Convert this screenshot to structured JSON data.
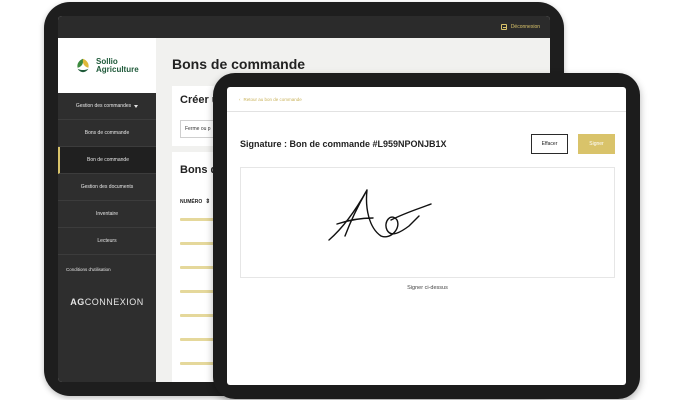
{
  "back_app": {
    "logout_label": "Déconnexion",
    "logo_line1": "Sollio",
    "logo_line2": "Agriculture",
    "sidebar": {
      "group_label": "Gestion des commandes",
      "items": [
        {
          "label": "Bons de commande"
        },
        {
          "label": "Bon de commande"
        },
        {
          "label": "Gestion des documents"
        },
        {
          "label": "Inventaire"
        },
        {
          "label": "Lecteurs"
        }
      ],
      "terms_label": "Conditions d'utilisation",
      "brand_bold": "AG",
      "brand_rest": "CONNEXION"
    },
    "page_title": "Bons de commande",
    "create_card_title": "Créer u",
    "farm_field_value": "Ferme ou p",
    "list_card_title": "Bons d",
    "number_col_label": "NUMÉRO"
  },
  "front_app": {
    "back_link": "Retour au bon de commande",
    "signature_title": "Signature : Bon de commande #L959NPONJB1X",
    "clear_button": "Effacer",
    "sign_button": "Signer",
    "signature_caption": "Signer ci-dessus"
  },
  "colors": {
    "accent_gold": "#d9c36a",
    "sidebar_dark": "#2e2e2e",
    "brand_green": "#1f5a3a"
  }
}
